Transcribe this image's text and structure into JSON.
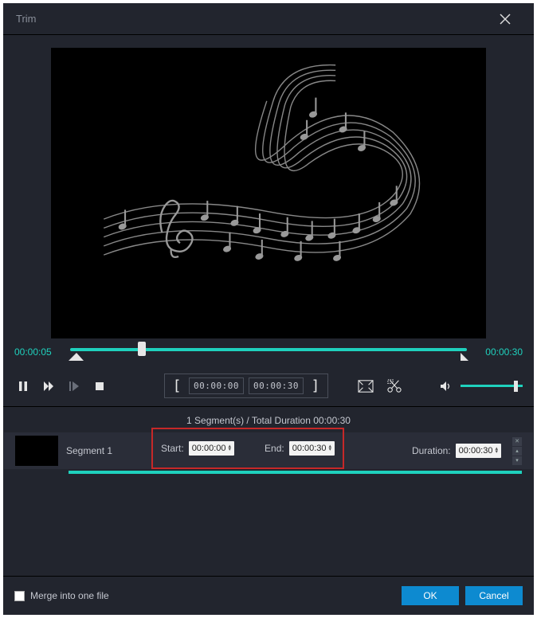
{
  "header": {
    "title": "Trim"
  },
  "preview": {
    "current_time": "00:00:05",
    "total_time": "00:00:30"
  },
  "controls": {
    "in_time": "00:00:00",
    "out_time": "00:00:30"
  },
  "status": "1 Segment(s) / Total Duration 00:00:30",
  "segment": {
    "name": "Segment 1",
    "start_label": "Start:",
    "start_value": "00:00:00",
    "end_label": "End:",
    "end_value": "00:00:30",
    "duration_label": "Duration:",
    "duration_value": "00:00:30"
  },
  "footer": {
    "merge_label": "Merge into one file",
    "ok": "OK",
    "cancel": "Cancel"
  }
}
